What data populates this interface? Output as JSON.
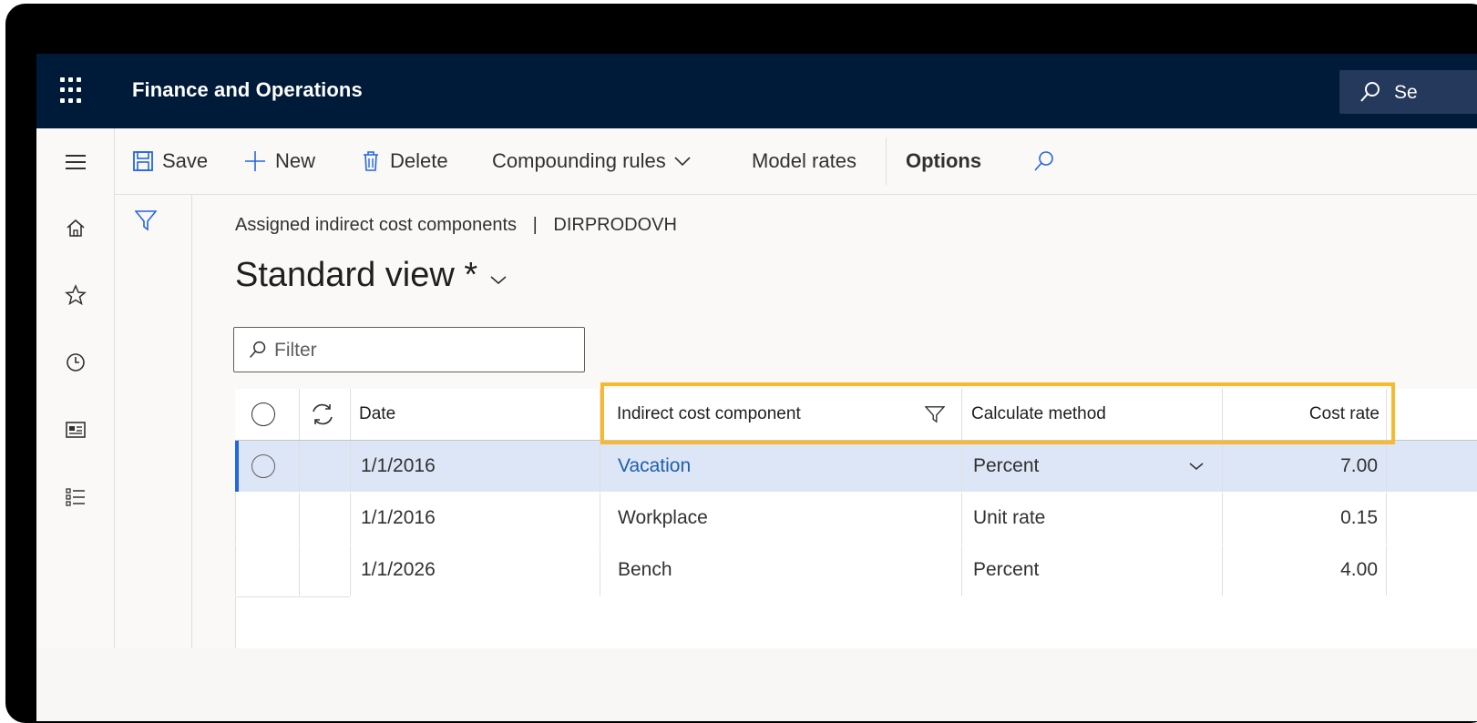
{
  "colors": {
    "topbar": "#001a39",
    "selected_row": "#dce6f7",
    "link": "#1f5fa8",
    "highlight": "#f7b92f"
  },
  "topbar": {
    "app_title": "Finance and Operations",
    "search_text": "Se"
  },
  "navrail": {
    "items": [
      {
        "icon": "hamburger-icon"
      },
      {
        "icon": "home-icon"
      },
      {
        "icon": "star-icon"
      },
      {
        "icon": "clock-icon"
      },
      {
        "icon": "workspace-icon"
      },
      {
        "icon": "modules-list-icon"
      }
    ]
  },
  "actionpane": {
    "save": "Save",
    "new": "New",
    "delete": "Delete",
    "compounding_rules": "Compounding rules",
    "model_rates": "Model rates",
    "options": "Options"
  },
  "page": {
    "caption_left": "Assigned indirect cost components",
    "caption_sep": "|",
    "caption_right": "DIRPRODOVH",
    "view_title": "Standard view *",
    "filter_placeholder": "Filter"
  },
  "grid": {
    "columns": {
      "date": "Date",
      "component": "Indirect cost component",
      "method": "Calculate method",
      "rate": "Cost rate"
    },
    "rows": [
      {
        "date": "1/1/2016",
        "component": "Vacation",
        "method": "Percent",
        "rate": "7.00",
        "selected": true
      },
      {
        "date": "1/1/2016",
        "component": "Workplace",
        "method": "Unit rate",
        "rate": "0.15",
        "selected": false
      },
      {
        "date": "1/1/2026",
        "component": "Bench",
        "method": "Percent",
        "rate": "4.00",
        "selected": false
      }
    ]
  }
}
